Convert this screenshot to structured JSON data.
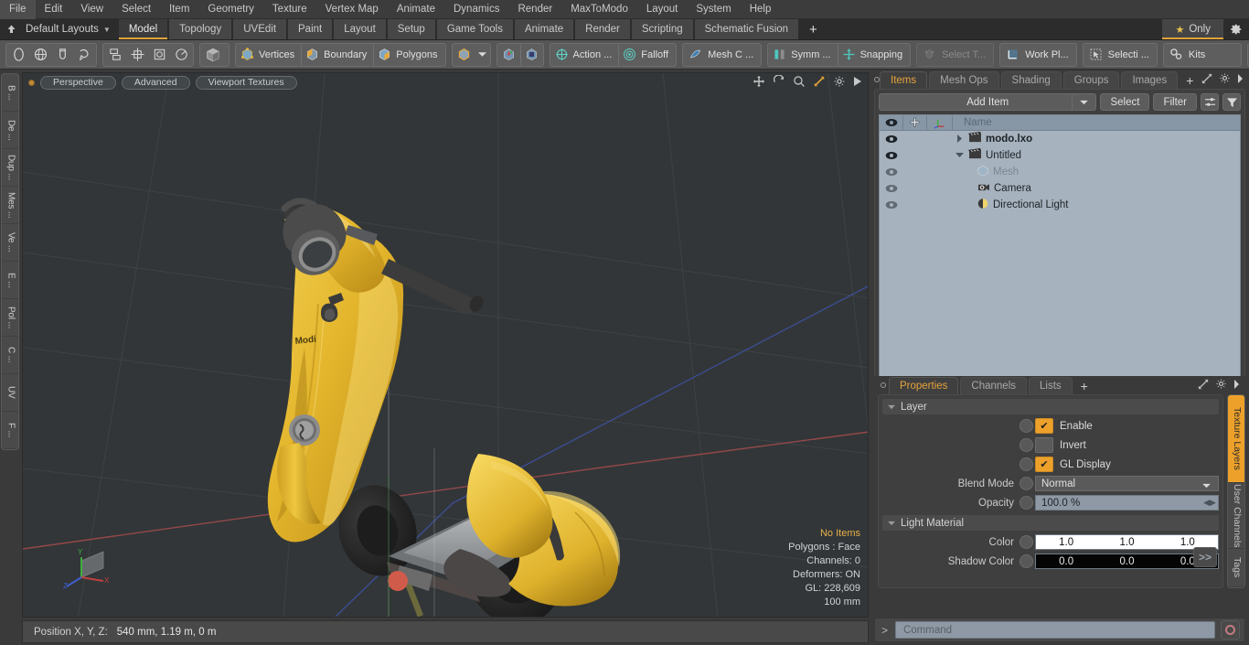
{
  "menu": {
    "items": [
      "File",
      "Edit",
      "View",
      "Select",
      "Item",
      "Geometry",
      "Texture",
      "Vertex Map",
      "Animate",
      "Dynamics",
      "Render",
      "MaxToModo",
      "Layout",
      "System",
      "Help"
    ]
  },
  "layoutbar": {
    "layout_name": "Default Layouts",
    "tabs": [
      {
        "label": "Model",
        "active": true
      },
      {
        "label": "Topology",
        "active": false
      },
      {
        "label": "UVEdit",
        "active": false
      },
      {
        "label": "Paint",
        "active": false
      },
      {
        "label": "Layout",
        "active": false
      },
      {
        "label": "Setup",
        "active": false
      },
      {
        "label": "Game Tools",
        "active": false
      },
      {
        "label": "Animate",
        "active": false
      },
      {
        "label": "Render",
        "active": false
      },
      {
        "label": "Scripting",
        "active": false
      },
      {
        "label": "Schematic Fusion",
        "active": false
      }
    ],
    "add_label": "+",
    "only_label": "Only",
    "gear_icon": "gear-icon",
    "star_icon": "star-icon",
    "home_icon": "home-icon"
  },
  "toolbar": {
    "falloff_group": [
      "circle-falloff-icon",
      "sphere-falloff-icon",
      "cylinder-falloff-icon",
      "lasso-falloff-icon"
    ],
    "transform_group": [
      "align-icon",
      "center-icon",
      "box-icon",
      "radial-icon"
    ],
    "solid_icon": "solid-shading-icon",
    "selection_modes": [
      {
        "label": "Vertices",
        "icon": "vertices-icon"
      },
      {
        "label": "Boundary",
        "icon": "boundary-icon"
      },
      {
        "label": "Polygons",
        "icon": "polygons-icon"
      }
    ],
    "item_mode_icon": "item-mode-icon",
    "item_mode_caret": "chevron-down-icon",
    "mode_a_icon": "mode-a-icon",
    "mode_b_icon": "mode-b-icon",
    "action": {
      "label": "Action  ...",
      "icon": "action-center-icon"
    },
    "falloff": {
      "label": "Falloff",
      "icon": "falloff-icon"
    },
    "mesh_constraint": {
      "label": "Mesh C ...",
      "icon": "mesh-constraint-icon"
    },
    "symmetry": {
      "label": "Symm ...",
      "icon": "symmetry-icon"
    },
    "snapping": {
      "label": "Snapping",
      "icon": "snapping-icon"
    },
    "select_through": {
      "label": "Select T...",
      "icon": "select-through-icon",
      "disabled": true
    },
    "work_plane": {
      "label": "Work Pl...",
      "icon": "work-plane-icon"
    },
    "selection": {
      "label": "Selecti ...",
      "icon": "selection-icon"
    },
    "kits": {
      "label": "Kits",
      "icon": "kits-gears-icon"
    },
    "substance_icon": "substance-icon",
    "unreal_icon": "unreal-engine-icon"
  },
  "left_tabs": [
    "B ...",
    "De ...",
    "Dup ...",
    "Mes ...",
    "Ve ...",
    "E ...",
    "Pol ...",
    "C ...",
    "UV",
    "F ..."
  ],
  "viewport": {
    "pills": [
      "Perspective",
      "Advanced",
      "Viewport Textures"
    ],
    "icons": [
      "move-icon",
      "rotate-icon",
      "zoom-icon",
      "fit-icon",
      "gear-icon",
      "play-icon"
    ],
    "stats": {
      "selection": "No Items",
      "polygons": "Polygons : Face",
      "channels": "Channels: 0",
      "deformers": "Deformers: ON",
      "gl": "GL: 228,609",
      "grid": "100 mm"
    },
    "axis": {
      "x": "X",
      "y": "Y",
      "z": "Z"
    }
  },
  "statusbar": {
    "label": "Position X, Y, Z:",
    "value": "540 mm, 1.19 m, 0 m"
  },
  "items_panel": {
    "tabs": [
      {
        "label": "Items",
        "active": true
      },
      {
        "label": "Mesh Ops",
        "active": false
      },
      {
        "label": "Shading",
        "active": false
      },
      {
        "label": "Groups",
        "active": false
      },
      {
        "label": "Images",
        "active": false
      }
    ],
    "add_tab_label": "+",
    "expand_icon": "expand-icon",
    "gear_icon": "gear-icon",
    "more_icon": "chevron-right-icon",
    "add_item_label": "Add Item",
    "select_label": "Select",
    "filter_label": "Filter",
    "list_opts_icon": "list-options-icon",
    "funnel_icon": "funnel-icon",
    "columns": {
      "visibility_icon": "eye-icon",
      "lock_icon": "plus-lock-icon",
      "transform_icon": "axis-icon",
      "name": "Name"
    },
    "rows": [
      {
        "name": "modo.lxo",
        "icon": "scene-icon",
        "bold": true,
        "indent": 0,
        "triangle": "collapsed",
        "eye": "dark",
        "dim": false
      },
      {
        "name": "Untitled",
        "icon": "scene-icon",
        "bold": false,
        "indent": 0,
        "triangle": "expanded",
        "eye": "dark",
        "dim": false
      },
      {
        "name": "Mesh",
        "icon": "mesh-icon",
        "bold": false,
        "indent": 1,
        "triangle": "none",
        "eye": "light",
        "dim": true
      },
      {
        "name": "Camera",
        "icon": "camera-icon",
        "bold": false,
        "indent": 1,
        "triangle": "none",
        "eye": "light",
        "dim": false
      },
      {
        "name": "Directional Light",
        "icon": "light-icon",
        "bold": false,
        "indent": 1,
        "triangle": "none",
        "eye": "light",
        "dim": false
      }
    ]
  },
  "properties_panel": {
    "tabs": [
      {
        "label": "Properties",
        "active": true
      },
      {
        "label": "Channels",
        "active": false
      },
      {
        "label": "Lists",
        "active": false
      }
    ],
    "add_tab_label": "+",
    "expand_icon": "expand-icon",
    "gear_icon": "gear-icon",
    "more_icon": "chevron-right-icon",
    "sections": [
      {
        "title": "Layer",
        "rows": [
          {
            "type": "checkbox",
            "label": "Enable",
            "checked": true
          },
          {
            "type": "checkbox",
            "label": "Invert",
            "checked": false
          },
          {
            "type": "checkbox",
            "label": "GL Display",
            "checked": true
          },
          {
            "type": "dropdown",
            "label": "Blend Mode",
            "value": "Normal"
          },
          {
            "type": "numeric",
            "label": "Opacity",
            "value": "100.0 %"
          }
        ]
      },
      {
        "title": "Light Material",
        "rows": [
          {
            "type": "color",
            "label": "Color",
            "swatch": "white",
            "values": [
              "1.0",
              "1.0",
              "1.0"
            ]
          },
          {
            "type": "color",
            "label": "Shadow Color",
            "swatch": "black",
            "values": [
              "0.0",
              "0.0",
              "0.0"
            ]
          }
        ]
      }
    ],
    "forward_label": ">>",
    "side_tabs": [
      {
        "label": "Texture Layers",
        "active": true
      },
      {
        "label": "User Channels",
        "active": false
      },
      {
        "label": "Tags",
        "active": false
      }
    ]
  },
  "command_bar": {
    "prompt": ">",
    "placeholder": "Command",
    "record_icon": "record-icon"
  },
  "colors": {
    "accent_orange": "#eda12b",
    "panel_bg": "#3a3a3a",
    "toolbar_bg": "#565656",
    "viewport_bg": "#323638",
    "list_bg": "#a6b2bd",
    "field_bg": "#8e99a5",
    "model_yellow": "#e8bb2a"
  }
}
